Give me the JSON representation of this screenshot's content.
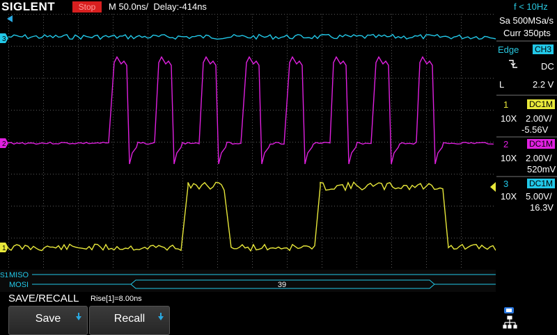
{
  "brand": "SIGLENT",
  "run_state": "Stop",
  "timebase": "M 50.0ns/",
  "delay": "Delay:-414ns",
  "trigger_freq": "f < 10Hz",
  "acquisition": {
    "sample_rate": "Sa 500MSa/s",
    "points": "Curr 350pts"
  },
  "trigger": {
    "type": "Edge",
    "source": "CH3",
    "coupling": "DC",
    "level_label": "L",
    "level": "2.2 V"
  },
  "channels": [
    {
      "num": "1",
      "coupling": "DC1M",
      "probe": "10X",
      "scale": "2.00V/",
      "offset": "-5.56V",
      "color": "#e8e83a"
    },
    {
      "num": "2",
      "coupling": "DC1M",
      "probe": "10X",
      "scale": "2.00V/",
      "offset": "520mV",
      "color": "#e020e0"
    },
    {
      "num": "3",
      "coupling": "DC1M",
      "probe": "10X",
      "scale": "5.00V/",
      "offset": "16.3V",
      "color": "#22c8e8"
    }
  ],
  "trace_markers": {
    "ch1": "1",
    "ch2": "2",
    "ch3": "3",
    "serial": "S1"
  },
  "decode": {
    "miso_label": "MISO",
    "mosi_label": "MOSI",
    "mosi_value": "39"
  },
  "menu": {
    "title": "SAVE/RECALL",
    "save": "Save",
    "recall": "Recall"
  },
  "measurement": "Rise[1]=8.00ns",
  "colors": {
    "ch1": "#e8e83a",
    "ch2": "#e020e0",
    "ch3": "#22c8e8",
    "grid": "#5a5a5a",
    "stop": "#d81f1f",
    "accent": "#2aa8e0"
  }
}
